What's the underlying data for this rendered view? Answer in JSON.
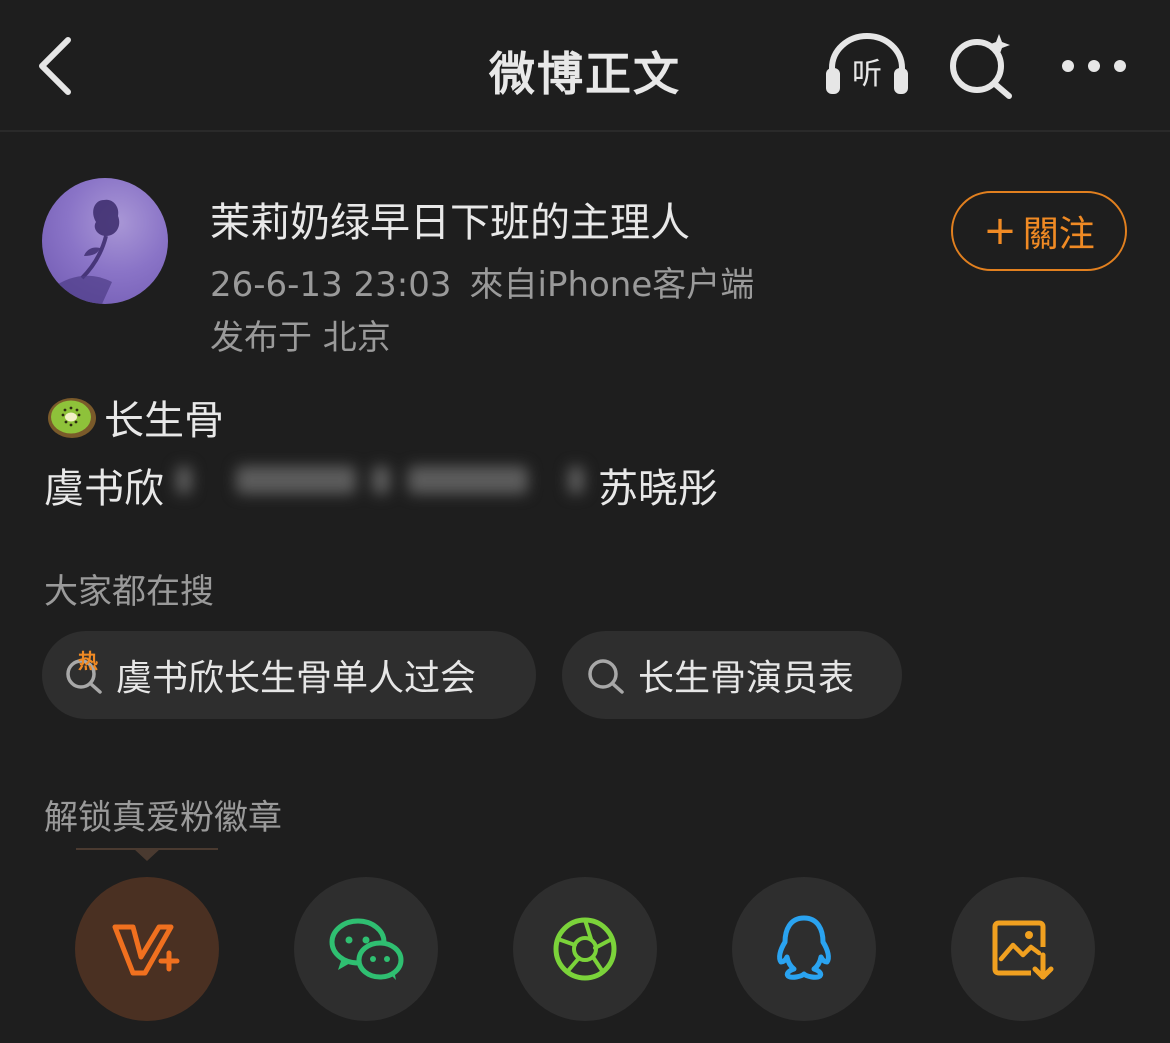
{
  "nav": {
    "title": "微博正文",
    "listen_label": "听",
    "icons": [
      "back-chevron-icon",
      "headphones-listen-icon",
      "ai-search-icon",
      "more-dots-icon"
    ]
  },
  "author": {
    "name": "茉莉奶绿早日下班的主理人",
    "timestamp": "26-6-13 23:03",
    "source": "來自iPhone客户端",
    "location": "发布于 北京",
    "follow_label": "關注",
    "follow_plus": "+"
  },
  "post": {
    "emoji": "kiwi-fruit-icon",
    "title": "长生骨",
    "name_left": "虞书欣",
    "name_right": "苏晓彤"
  },
  "search": {
    "label": "大家都在搜",
    "hot_badge": "热",
    "chips": [
      {
        "label": "虞书欣长生骨单人过会",
        "hot": true
      },
      {
        "label": "长生骨演员表",
        "hot": false
      }
    ]
  },
  "share": {
    "label": "解锁真爱粉徽章",
    "targets": [
      "vip-plus-icon",
      "wechat-icon",
      "moments-icon",
      "qq-icon",
      "save-image-icon"
    ]
  },
  "colors": {
    "background": "#1e1e1e",
    "accent": "#f08a24",
    "text_primary": "#e8e8e8",
    "text_secondary": "#9a9a9a",
    "chip_bg": "#2e2e2e",
    "wechat": "#2fbf71",
    "moments": "#7bd33a",
    "qq": "#2aa3f0",
    "save": "#f0a020"
  }
}
